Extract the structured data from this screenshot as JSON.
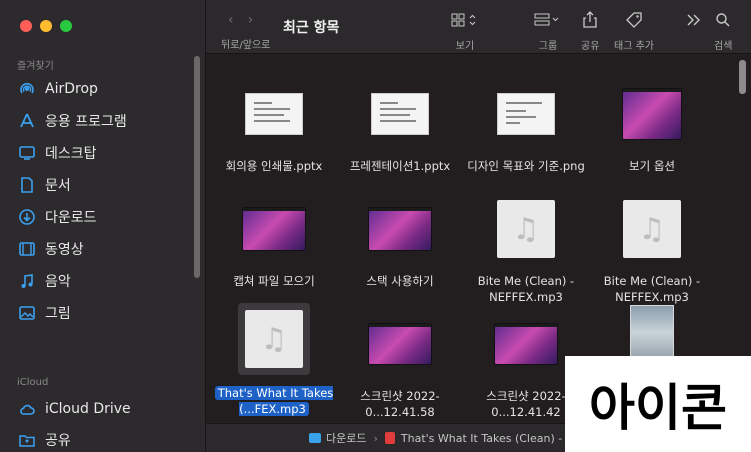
{
  "sidebar": {
    "favorites_header": "즐겨찾기",
    "favorites": [
      {
        "label": "AirDrop",
        "icon": "airdrop-icon"
      },
      {
        "label": "응용 프로그램",
        "icon": "applications-icon"
      },
      {
        "label": "데스크탑",
        "icon": "desktop-icon"
      },
      {
        "label": "문서",
        "icon": "document-icon"
      },
      {
        "label": "다운로드",
        "icon": "download-icon"
      },
      {
        "label": "동영상",
        "icon": "movies-icon"
      },
      {
        "label": "음악",
        "icon": "music-icon"
      },
      {
        "label": "그림",
        "icon": "pictures-icon"
      }
    ],
    "icloud_header": "iCloud",
    "icloud": [
      {
        "label": "iCloud Drive",
        "icon": "cloud-icon"
      },
      {
        "label": "공유",
        "icon": "shared-folder-icon"
      }
    ]
  },
  "toolbar": {
    "nav_label": "뒤로/앞으로",
    "title": "최근 항목",
    "view_label": "보기",
    "group_label": "그룹",
    "share_label": "공유",
    "tag_label": "태그 추가",
    "search_label": "검색"
  },
  "files": [
    {
      "name": "회의용 인쇄물.pptx",
      "kind": "doc"
    },
    {
      "name": "프레젠테이션1.pptx",
      "kind": "doc"
    },
    {
      "name": "디자인 목표와 기준.png",
      "kind": "doc"
    },
    {
      "name": "보기 옵션",
      "kind": "wall"
    },
    {
      "name": "캡쳐 파일 모으기",
      "kind": "wall"
    },
    {
      "name": "스택 사용하기",
      "kind": "wall"
    },
    {
      "name": "Bite Me (Clean) - NEFFEX.mp3",
      "kind": "audio"
    },
    {
      "name": "Bite Me (Clean) - NEFFEX.mp3",
      "kind": "audio"
    },
    {
      "name": "That's What It Takes (...FEX.mp3",
      "kind": "audio",
      "selected": true
    },
    {
      "name": "스크린샷 2022-0...12.41.58",
      "kind": "wall"
    },
    {
      "name": "스크린샷 2022-0...12.41.42",
      "kind": "wall"
    },
    {
      "name": "",
      "kind": "photo"
    }
  ],
  "pathbar": {
    "folder": "다운로드",
    "file": "That's What It Takes (Clean) - N"
  },
  "caption": "아이콘",
  "colors": {
    "selection": "#1e62c8",
    "folder_icon": "#3aa2e8"
  }
}
